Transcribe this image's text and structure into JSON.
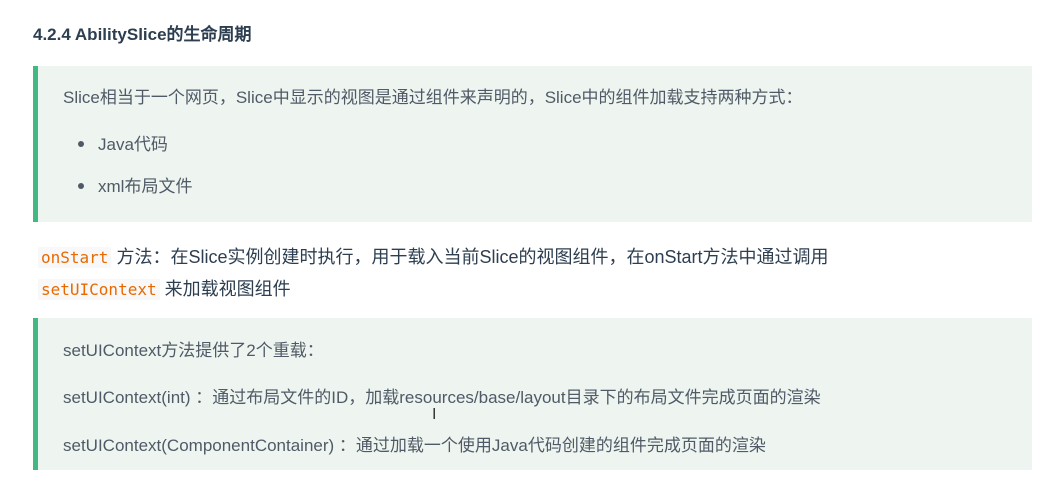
{
  "heading": "4.2.4 AbilitySlice的生命周期",
  "tip1": {
    "intro": "Slice相当于一个网页，Slice中显示的视图是通过组件来声明的，Slice中的组件加载支持两种方式：",
    "items": [
      "Java代码",
      "xml布局文件"
    ]
  },
  "paragraph": {
    "code1": "onStart",
    "text1": "方法：在Slice实例创建时执行，用于载入当前Slice的视图组件，在onStart方法中通过调用",
    "code2": "setUIContext",
    "text2": "来加载视图组件"
  },
  "tip2": {
    "line1": "setUIContext方法提供了2个重载：",
    "line2": "setUIContext(int) ：通过布局文件的ID，加载resources/base/layout目录下的布局文件完成页面的渲染",
    "line3": "setUIContext(ComponentContainer) ：通过加载一个使用Java代码创建的组件完成页面的渲染"
  },
  "colors": {
    "accent": "#42b983",
    "tip_bg": "#eef5f0",
    "code": "#e96900"
  },
  "icons": {
    "cursor": "text-cursor-icon"
  }
}
